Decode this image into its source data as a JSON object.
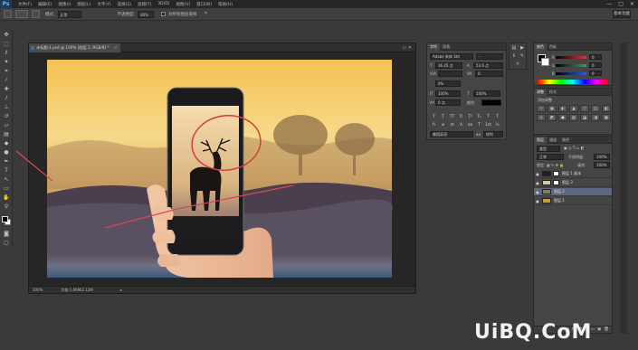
{
  "app": {
    "logo": "Ps",
    "menu": [
      "文件(F)",
      "编辑(E)",
      "图像(I)",
      "图层(L)",
      "文字(Y)",
      "选择(S)",
      "滤镜(T)",
      "3D(D)",
      "视图(V)",
      "窗口(W)",
      "帮助(H)"
    ],
    "window_controls": [
      "—",
      "□",
      "✕"
    ]
  },
  "options_bar": {
    "mode_label": "模式:",
    "mode_value": "正常",
    "opacity_label": "不透明度:",
    "opacity_value": "80%",
    "checkbox_label": "对所有图层取样",
    "workspace": "基本功能"
  },
  "document": {
    "tab_title": "未标题-1.psd @ 100% (图层 2, RGB/8) *",
    "close_label": "×",
    "zoom": "100%",
    "file_info": "文档:1.06M/2.12M"
  },
  "character_panel": {
    "tabs": [
      "字符",
      "段落"
    ],
    "font_family": "Adobe 宋体 Std",
    "font_style": "-",
    "size": "36.45 点",
    "leading": "53.6 点",
    "kerning_label": "V/A",
    "tracking": "0",
    "percent": "0%",
    "vscale": "100%",
    "hscale": "100%",
    "baseline": "0 点",
    "color_label": "颜色:",
    "style_buttons": [
      "T",
      "T",
      "TT",
      "Tr",
      "T¹",
      "T₁",
      "T",
      "T"
    ],
    "extra_buttons": [
      "fi",
      "ø",
      "st",
      "A",
      "aa",
      "T",
      "1st",
      "½"
    ],
    "language": "美国英语",
    "aa_mode": "锐利"
  },
  "color_panel": {
    "tabs": [
      "颜色",
      "色板"
    ],
    "channels": [
      {
        "name": "R",
        "value": "0",
        "color": "#d9363e"
      },
      {
        "name": "G",
        "value": "0",
        "color": "#2fa84f"
      },
      {
        "name": "B",
        "value": "0",
        "color": "#2f5bd9"
      }
    ]
  },
  "styles_panel": {
    "tabs": [
      "调整",
      "样式"
    ],
    "title": "添加调整",
    "cells": [
      "☼",
      "▦",
      "◐",
      "▲",
      "▽",
      "◫",
      "◧",
      "⚖",
      "◩",
      "●",
      "▨",
      "◪",
      "◨",
      "▩"
    ]
  },
  "layers_panel": {
    "tabs": [
      "图层",
      "通道",
      "路径"
    ],
    "filter_label": "类型",
    "blend_mode": "正常",
    "opacity_label": "不透明度:",
    "opacity": "100%",
    "lock_label": "锁定:",
    "fill_label": "填充:",
    "fill": "100%",
    "layers": [
      {
        "name": "图层 1 副本",
        "visible": "●",
        "thumb": "#222",
        "has_mask": true,
        "active": false
      },
      {
        "name": "图层 3",
        "visible": "●",
        "thumb": "#d9c8a8",
        "has_mask": true,
        "active": false
      },
      {
        "name": "图层 2",
        "visible": "●",
        "thumb": "#8a7a5a",
        "has_mask": false,
        "active": true
      },
      {
        "name": "图层 1",
        "visible": "●",
        "thumb": "#c99a3a",
        "has_mask": false,
        "active": false
      }
    ],
    "footer_icons": [
      "ɕɔ",
      "fx",
      "◘",
      "◑",
      "▭",
      "▣",
      "🗑"
    ]
  },
  "watermark": "UiBQ.CoM"
}
